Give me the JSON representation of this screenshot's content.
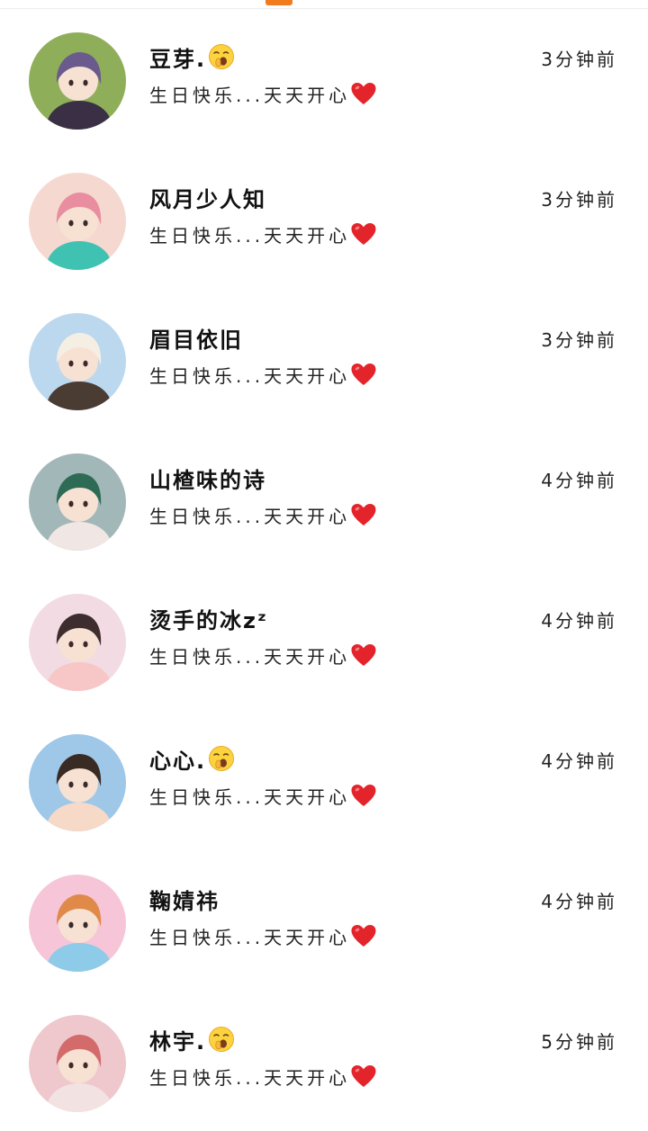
{
  "indicator_color": "#f07c1e",
  "messages": [
    {
      "name": "豆芽.",
      "emoji": "yawning-face-icon",
      "preview": "生日快乐...天天开心",
      "preview_emoji": "heart-icon",
      "time": "3分钟前",
      "avatar_palette": [
        "#8fae5a",
        "#6b5a8e",
        "#3a2f45"
      ]
    },
    {
      "name": "风月少人知",
      "emoji": "",
      "preview": "生日快乐...天天开心",
      "preview_emoji": "heart-icon",
      "time": "3分钟前",
      "avatar_palette": [
        "#f5d8d0",
        "#e88ea0",
        "#3fc2b2"
      ]
    },
    {
      "name": "眉目依旧",
      "emoji": "",
      "preview": "生日快乐...天天开心",
      "preview_emoji": "heart-icon",
      "time": "3分钟前",
      "avatar_palette": [
        "#bcd8ee",
        "#f5efe3",
        "#4a3b33"
      ]
    },
    {
      "name": "山楂味的诗",
      "emoji": "",
      "preview": "生日快乐...天天开心",
      "preview_emoji": "heart-icon",
      "time": "4分钟前",
      "avatar_palette": [
        "#a2b7b8",
        "#2e6b54",
        "#f0e6e3"
      ]
    },
    {
      "name": "烫手的冰zᶻ",
      "emoji": "",
      "preview": "生日快乐...天天开心",
      "preview_emoji": "heart-icon",
      "time": "4分钟前",
      "avatar_palette": [
        "#f2dbe3",
        "#3e2d2f",
        "#f7c6c7"
      ]
    },
    {
      "name": "心心.",
      "emoji": "yawning-face-icon",
      "preview": "生日快乐...天天开心",
      "preview_emoji": "heart-icon",
      "time": "4分钟前",
      "avatar_palette": [
        "#9ec7e8",
        "#3a2a24",
        "#f6d9c7"
      ]
    },
    {
      "name": "鞠婧祎",
      "emoji": "",
      "preview": "生日快乐...天天开心",
      "preview_emoji": "heart-icon",
      "time": "4分钟前",
      "avatar_palette": [
        "#f6c6d8",
        "#e08a4a",
        "#8ecbe9"
      ]
    },
    {
      "name": "林宇.",
      "emoji": "yawning-face-icon",
      "preview": "生日快乐...天天开心",
      "preview_emoji": "heart-icon",
      "time": "5分钟前",
      "avatar_palette": [
        "#efc8cd",
        "#d36b6b",
        "#f3e2e2"
      ]
    }
  ]
}
